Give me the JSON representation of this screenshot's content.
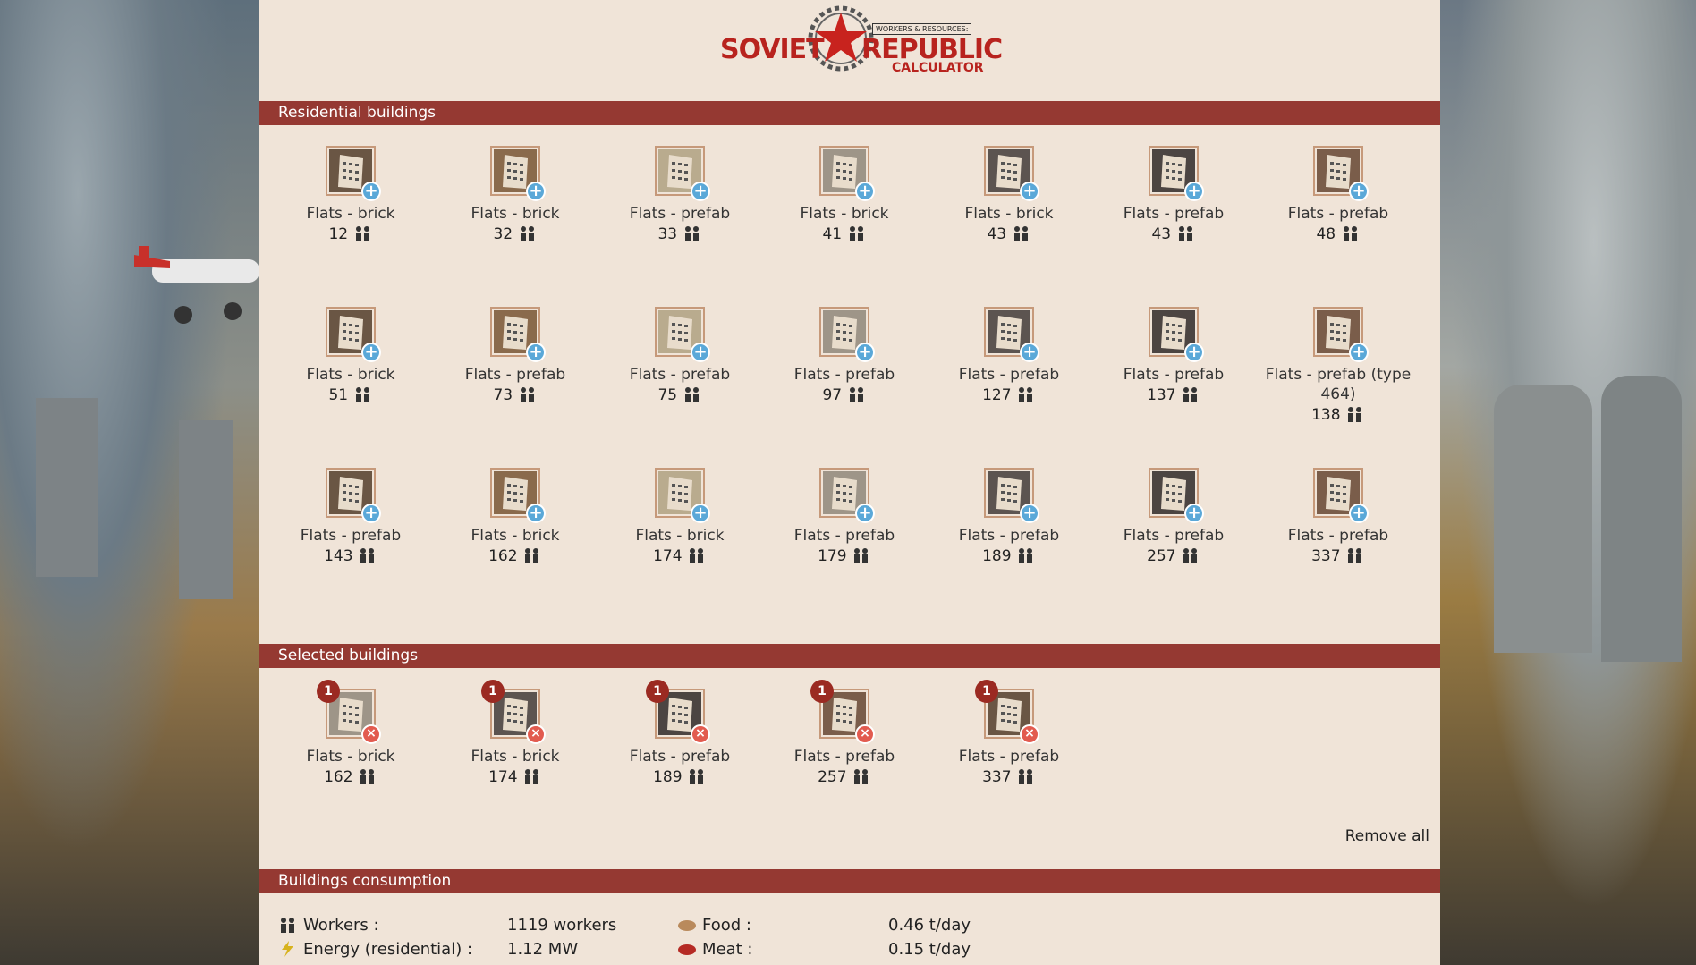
{
  "app": {
    "logo_left": "SOVIET",
    "logo_right": "REPUBLIC",
    "logo_sub": "CALCULATOR",
    "logo_badge": "WORKERS & RESOURCES:"
  },
  "sections": {
    "residential": "Residential buildings",
    "selected": "Selected buildings",
    "consumption": "Buildings consumption"
  },
  "residential_buildings": [
    {
      "name": "Flats - brick",
      "pop": "12"
    },
    {
      "name": "Flats - brick",
      "pop": "32"
    },
    {
      "name": "Flats - prefab",
      "pop": "33"
    },
    {
      "name": "Flats - brick",
      "pop": "41"
    },
    {
      "name": "Flats - brick",
      "pop": "43"
    },
    {
      "name": "Flats - prefab",
      "pop": "43"
    },
    {
      "name": "Flats - prefab",
      "pop": "48"
    },
    {
      "name": "Flats - brick",
      "pop": "51"
    },
    {
      "name": "Flats - prefab",
      "pop": "73"
    },
    {
      "name": "Flats - prefab",
      "pop": "75"
    },
    {
      "name": "Flats - prefab",
      "pop": "97"
    },
    {
      "name": "Flats - prefab",
      "pop": "127"
    },
    {
      "name": "Flats - prefab",
      "pop": "137"
    },
    {
      "name": "Flats - prefab (type 464)",
      "pop": "138"
    },
    {
      "name": "Flats - prefab",
      "pop": "143"
    },
    {
      "name": "Flats - brick",
      "pop": "162"
    },
    {
      "name": "Flats - brick",
      "pop": "174"
    },
    {
      "name": "Flats - prefab",
      "pop": "179"
    },
    {
      "name": "Flats - prefab",
      "pop": "189"
    },
    {
      "name": "Flats - prefab",
      "pop": "257"
    },
    {
      "name": "Flats - prefab",
      "pop": "337"
    }
  ],
  "selected_buildings": [
    {
      "name": "Flats - brick",
      "pop": "162",
      "count": "1"
    },
    {
      "name": "Flats - brick",
      "pop": "174",
      "count": "1"
    },
    {
      "name": "Flats - prefab",
      "pop": "189",
      "count": "1"
    },
    {
      "name": "Flats - prefab",
      "pop": "257",
      "count": "1"
    },
    {
      "name": "Flats - prefab",
      "pop": "337",
      "count": "1"
    }
  ],
  "remove_all_label": "Remove all",
  "consumption": {
    "workers_label": "Workers :",
    "workers_value": "1119 workers",
    "energy_label": "Energy (residential) :",
    "energy_value": "1.12 MW",
    "food_label": "Food :",
    "food_value": "0.46 t/day",
    "meat_label": "Meat :",
    "meat_value": "0.15 t/day"
  },
  "colors": {
    "header_bg": "#953932",
    "panel_bg": "#f0e4d8",
    "add_button": "#5aa8d8",
    "remove_button": "#e25b4f",
    "badge": "#9b2a22"
  }
}
